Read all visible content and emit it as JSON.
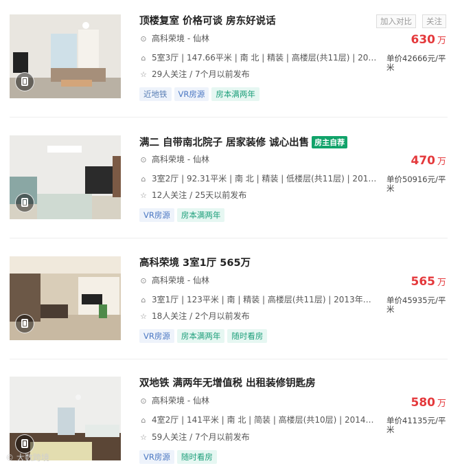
{
  "actions": {
    "compare_label": "加入对比",
    "follow_label": "关注"
  },
  "listings": [
    {
      "title": "顶楼复室 价格可谈 房东好说话",
      "badge": "",
      "community": "高科荣境 - 仙林",
      "attributes": "5室3厅 | 147.66平米 | 南 北 | 精装 | 高楼层(共11层) | 2014...",
      "followers": "29人关注 / 7个月以前发布",
      "price": "630",
      "price_unit": "万",
      "unit_price": "单价42666元/平米",
      "tags": [
        "近地铁",
        "VR房源",
        "房本满两年"
      ]
    },
    {
      "title": "满二 自带南北院子 居家装修 诚心出售",
      "badge": "房主自荐",
      "community": "高科荣境 - 仙林",
      "attributes": "3室2厅 | 92.31平米 | 南 北 | 精装 | 低楼层(共11层) | 2014年...",
      "followers": "12人关注 / 25天以前发布",
      "price": "470",
      "price_unit": "万",
      "unit_price": "单价50916元/平米",
      "tags": [
        "VR房源",
        "房本满两年"
      ]
    },
    {
      "title": "高科荣境 3室1厅 565万",
      "badge": "",
      "community": "高科荣境 - 仙林",
      "attributes": "3室1厅 | 123平米 | 南 | 精装 | 高楼层(共11层) | 2013年建 | ...",
      "followers": "18人关注 / 2个月以前发布",
      "price": "565",
      "price_unit": "万",
      "unit_price": "单价45935元/平米",
      "tags": [
        "VR房源",
        "房本满两年",
        "随时看房"
      ]
    },
    {
      "title": "双地铁 满两年无增值税 出租装修钥匙房",
      "badge": "",
      "community": "高科荣境 - 仙林",
      "attributes": "4室2厅 | 141平米 | 南 北 | 简装 | 高楼层(共10层) | 2014年建 ...",
      "followers": "59人关注 / 7个月以前发布",
      "price": "580",
      "price_unit": "万",
      "unit_price": "单价41135元/平米",
      "tags": [
        "VR房源",
        "随时看房"
      ]
    }
  ],
  "watermark": "© 大数跨境"
}
